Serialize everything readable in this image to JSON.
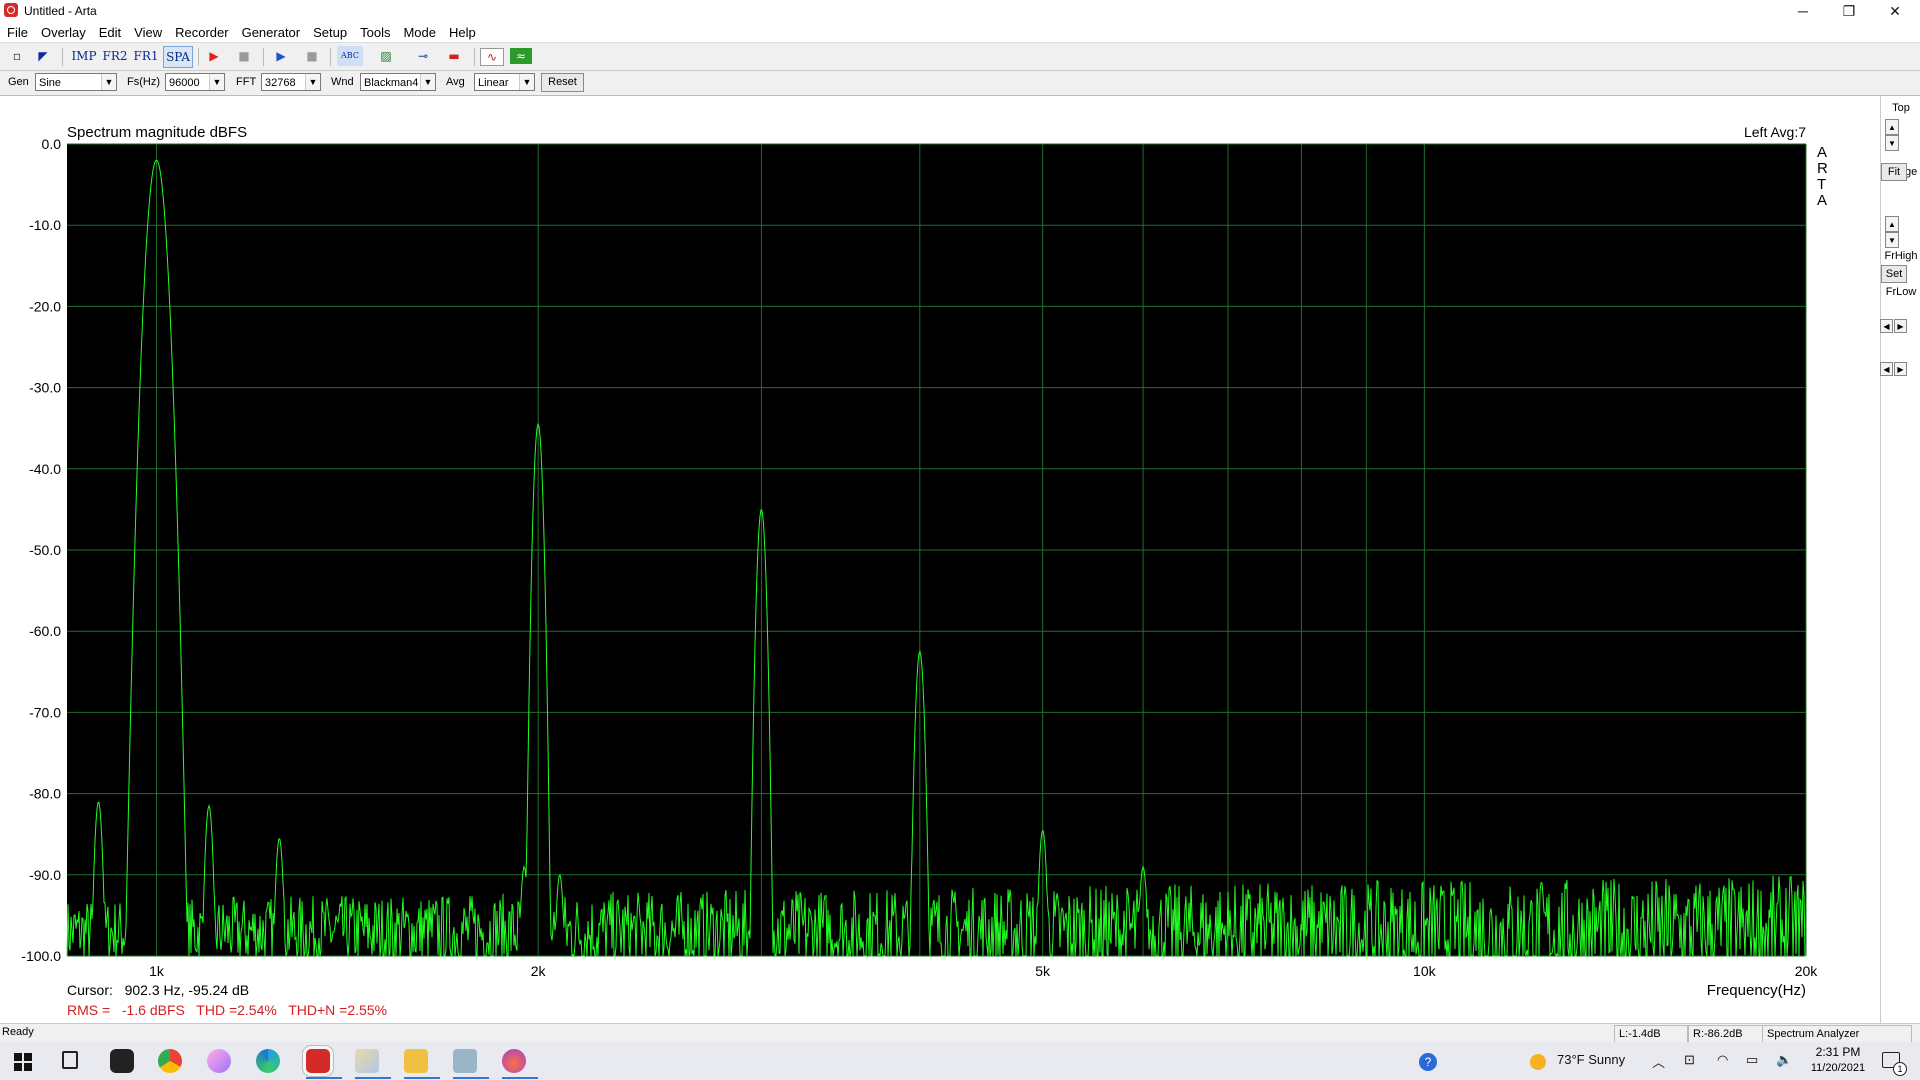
{
  "window": {
    "title": "Untitled - Arta",
    "minimize": "─",
    "restore": "❐",
    "close": "✕"
  },
  "menu": [
    "File",
    "Overlay",
    "Edit",
    "View",
    "Recorder",
    "Generator",
    "Setup",
    "Tools",
    "Mode",
    "Help"
  ],
  "toolbar": {
    "buttons": [
      {
        "name": "new-icon",
        "label": "▫"
      },
      {
        "name": "open-icon",
        "label": "◤"
      },
      {
        "name": "imp-mode-button",
        "label": "IMP"
      },
      {
        "name": "fr2-mode-button",
        "label": "FR2"
      },
      {
        "name": "fr1-mode-button",
        "label": "FR1"
      },
      {
        "name": "spa-mode-button",
        "label": "SPA"
      },
      {
        "name": "record-icon",
        "label": "▶"
      },
      {
        "name": "stop-icon",
        "label": "■"
      },
      {
        "name": "play-icon",
        "label": "▶"
      },
      {
        "name": "stop2-icon",
        "label": "■"
      },
      {
        "name": "abc-icon",
        "label": "ABC"
      },
      {
        "name": "grid-icon",
        "label": "▨"
      },
      {
        "name": "cable-icon",
        "label": "⊸"
      },
      {
        "name": "meter-icon",
        "label": "▬"
      },
      {
        "name": "wave-icon",
        "label": "∿"
      },
      {
        "name": "spectrum-icon",
        "label": "≈"
      }
    ],
    "accent_record": "#e02020",
    "accent_play": "#1a55c8"
  },
  "options": {
    "gen_label": "Gen",
    "gen_value": "Sine",
    "fs_label": "Fs(Hz)",
    "fs_value": "96000",
    "fft_label": "FFT",
    "fft_value": "32768",
    "wnd_label": "Wnd",
    "wnd_value": "Blackman4",
    "avg_label": "Avg",
    "avg_value": "Linear",
    "reset_label": "Reset"
  },
  "side": {
    "top_label": "Top",
    "fit_label": "Fit",
    "range_label": "Range",
    "set_label": "Set",
    "frhigh_label": "FrHigh",
    "frlow_label": "FrLow",
    "up": "▲",
    "down": "▼",
    "left": "◀",
    "right": "▶"
  },
  "plot": {
    "cursor_text": "Cursor:   902.3 Hz, -95.24 dB",
    "measurements": "RMS =   -1.6 dBFS   THD =2.54%   THD+N =2.55%",
    "arta_letters": [
      "A",
      "R",
      "T",
      "A"
    ]
  },
  "chart_data": {
    "type": "line",
    "title": "Spectrum magnitude dBFS",
    "channel_label": "Left  Avg:7",
    "xlabel": "Frequency(Hz)",
    "ylabel": "",
    "x_scale": "log",
    "xlim": [
      850,
      20000
    ],
    "ylim": [
      -100,
      0
    ],
    "y_ticks": [
      "0.0",
      "-10.0",
      "-20.0",
      "-30.0",
      "-40.0",
      "-50.0",
      "-60.0",
      "-70.0",
      "-80.0",
      "-90.0",
      "-100.0"
    ],
    "x_ticks": [
      {
        "v": 1000,
        "label": "1k"
      },
      {
        "v": 2000,
        "label": "2k"
      },
      {
        "v": 5000,
        "label": "5k"
      },
      {
        "v": 10000,
        "label": "10k"
      },
      {
        "v": 20000,
        "label": "20k"
      }
    ],
    "x_gridlines": [
      1000,
      2000,
      3000,
      4000,
      5000,
      6000,
      7000,
      8000,
      9000,
      10000,
      20000
    ],
    "grid": true,
    "line_color": "#22ff22",
    "background": "#000000",
    "grid_color": "#1f6f2a",
    "peaks": [
      {
        "x": 1000,
        "y": -2
      },
      {
        "x": 2000,
        "y": -34.5
      },
      {
        "x": 3000,
        "y": -45
      },
      {
        "x": 4000,
        "y": -62.5
      },
      {
        "x": 5000,
        "y": -84.5
      },
      {
        "x": 6000,
        "y": -89
      },
      {
        "x": 900,
        "y": -81
      },
      {
        "x": 1100,
        "y": -81.5
      },
      {
        "x": 1250,
        "y": -85.5
      },
      {
        "x": 1950,
        "y": -89
      },
      {
        "x": 2080,
        "y": -90
      }
    ],
    "noise_floor": -97
  },
  "status": {
    "ready": "Ready",
    "left_level": "L:-1.4dB",
    "right_level": "R:-86.2dB",
    "mode": "Spectrum Analyzer"
  },
  "taskbar": {
    "weather": "73°F  Sunny",
    "time": "2:31 PM",
    "date": "11/20/2021",
    "notif_count": "1"
  }
}
